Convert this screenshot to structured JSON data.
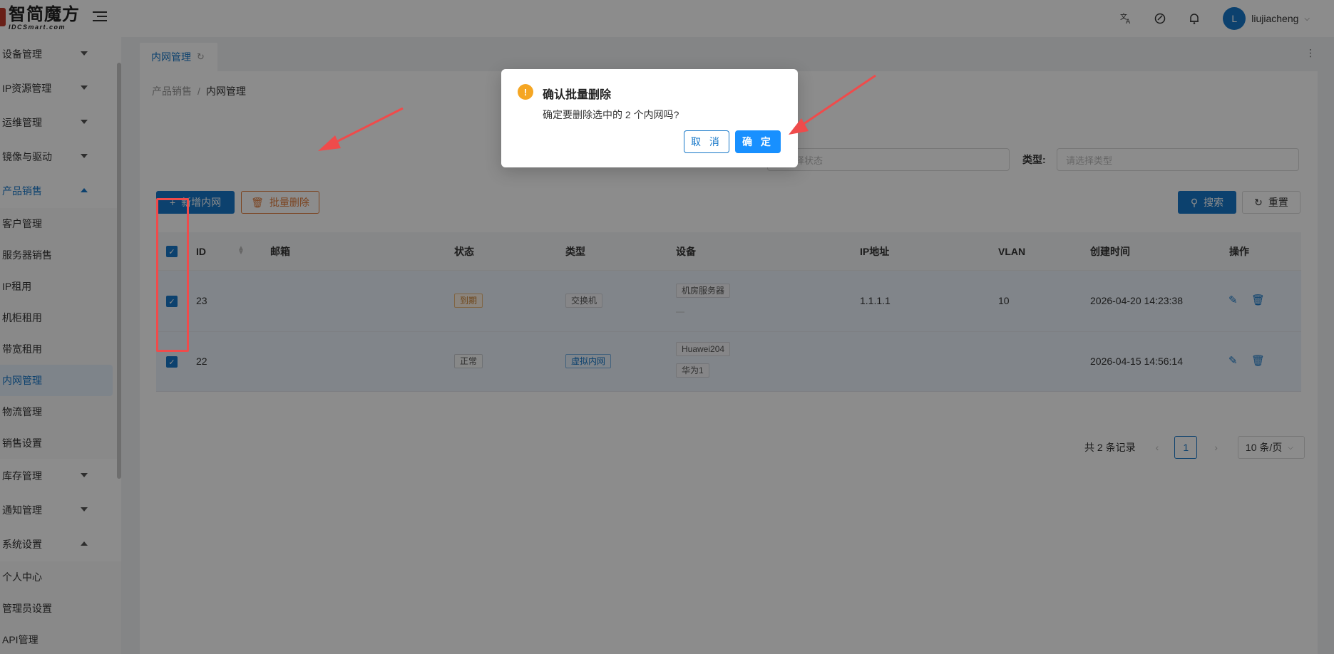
{
  "app": {
    "logo_main": "智简魔方",
    "logo_sub": "IDCSmart.com"
  },
  "topbar": {
    "translate_icon": "translate-icon",
    "theme_icon": "palette-icon",
    "bell_icon": "bell-icon",
    "avatar_letter": "L",
    "username": "liujiacheng"
  },
  "sidebar": {
    "items": [
      {
        "label": "设备管理",
        "expanded": false
      },
      {
        "label": "IP资源管理",
        "expanded": false
      },
      {
        "label": "运维管理",
        "expanded": false
      },
      {
        "label": "镜像与驱动",
        "expanded": false
      },
      {
        "label": "产品销售",
        "expanded": true
      }
    ],
    "sales_sub": [
      "客户管理",
      "服务器销售",
      "IP租用",
      "机柜租用",
      "带宽租用",
      "内网管理",
      "物流管理",
      "销售设置"
    ],
    "after": [
      {
        "label": "库存管理",
        "expanded": false
      },
      {
        "label": "通知管理",
        "expanded": false
      },
      {
        "label": "系统设置",
        "expanded": true
      }
    ],
    "system_sub": [
      "个人中心",
      "管理员设置",
      "API管理"
    ]
  },
  "tabs": [
    {
      "label": "内网管理"
    }
  ],
  "breadcrumb": {
    "parent": "产品销售",
    "sep": "/",
    "current": "内网管理"
  },
  "filters": {
    "status_placeholder": "请选择状态",
    "status_visible": "状态",
    "type_label": "类型:",
    "type_placeholder": "请选择类型"
  },
  "toolbar": {
    "add_label": "新增内网",
    "batch_delete_label": "批量删除",
    "search_label": "搜索",
    "reset_label": "重置"
  },
  "table": {
    "columns": [
      "ID",
      "邮箱",
      "状态",
      "类型",
      "设备",
      "IP地址",
      "VLAN",
      "创建时间",
      "操作"
    ],
    "rows": [
      {
        "id": "23",
        "email": "",
        "status": "到期",
        "type": "交换机",
        "devices": [
          "机房服务器"
        ],
        "device_extra": "—",
        "ip": "1.1.1.1",
        "vlan": "10",
        "created": "2026-04-20 14:23:38"
      },
      {
        "id": "22",
        "email": "",
        "status": "正常",
        "type": "虚拟内网",
        "devices": [
          "Huawei204",
          "华为1"
        ],
        "device_extra": "",
        "ip": "",
        "vlan": "",
        "created": "2026-04-15 14:56:14"
      }
    ]
  },
  "pager": {
    "total": "共 2 条记录",
    "page": "1",
    "page_size": "10 条/页"
  },
  "modal": {
    "title": "确认批量删除",
    "body": "确定要删除选中的 2 个内网吗?",
    "cancel": "取 消",
    "ok": "确 定"
  },
  "colors": {
    "primary": "#1677c8",
    "warning": "#f5a623",
    "danger": "#e07b3a",
    "annotation": "#ef4b4b"
  }
}
